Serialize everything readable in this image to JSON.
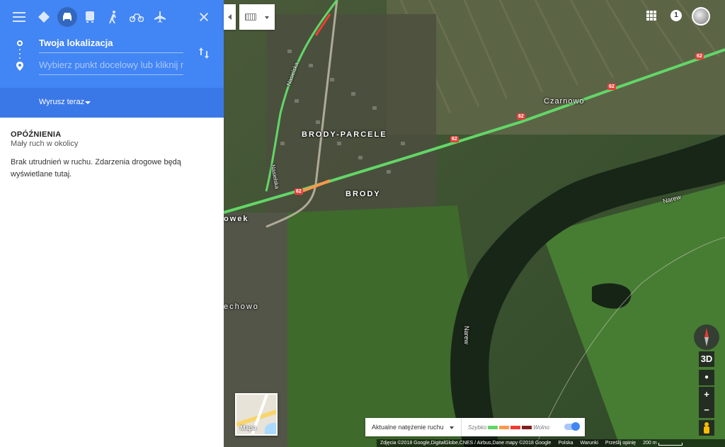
{
  "directions": {
    "origin_value": "Twoja lokalizacja",
    "destination_placeholder": "Wybierz punkt docelowy lub kliknij mapę",
    "depart_label": "Wyrusz teraz"
  },
  "modes": [
    "menu-icon",
    "best-route-icon",
    "car-icon",
    "transit-icon",
    "walk-icon",
    "bike-icon",
    "flight-icon",
    "close-icon"
  ],
  "traffic_info": {
    "title": "OPÓŹNIENIA",
    "subtitle": "Mały ruch w okolicy",
    "message": "Brak utrudnień w ruchu. Zdarzenia drogowe będą wyświetlane tutaj."
  },
  "top_right": {
    "notification_count": "1"
  },
  "map": {
    "labels": {
      "brody_parcele": "BRODY-PARCELE",
      "brody": "BRODY",
      "czarnowo": "Czarnowo",
      "owek": "owek",
      "echowo": "echowo",
      "narew_1": "Narew",
      "narew_2": "Narew",
      "nasielska_1": "Nasielska",
      "nasielska_2": "Nasielska"
    },
    "road_number": "62"
  },
  "controls": {
    "tilt_label": "3D",
    "zoom_in": "+",
    "zoom_out": "−",
    "minimap_label": "Mapa"
  },
  "traffic_bar": {
    "selector_label": "Aktualne natężenie ruchu",
    "fast_label": "Szybko",
    "slow_label": "Wolno",
    "legend_colors": [
      "#63d668",
      "#ff974d",
      "#f23c32",
      "#811f1f"
    ]
  },
  "footer": {
    "attribution": "Zdjęcia ©2018 Google,DigitalGlobe,CNES / Airbus,Dane mapy ©2018 Google",
    "country": "Polska",
    "terms": "Warunki",
    "feedback": "Prześlij opinię",
    "scale": "200 m"
  }
}
